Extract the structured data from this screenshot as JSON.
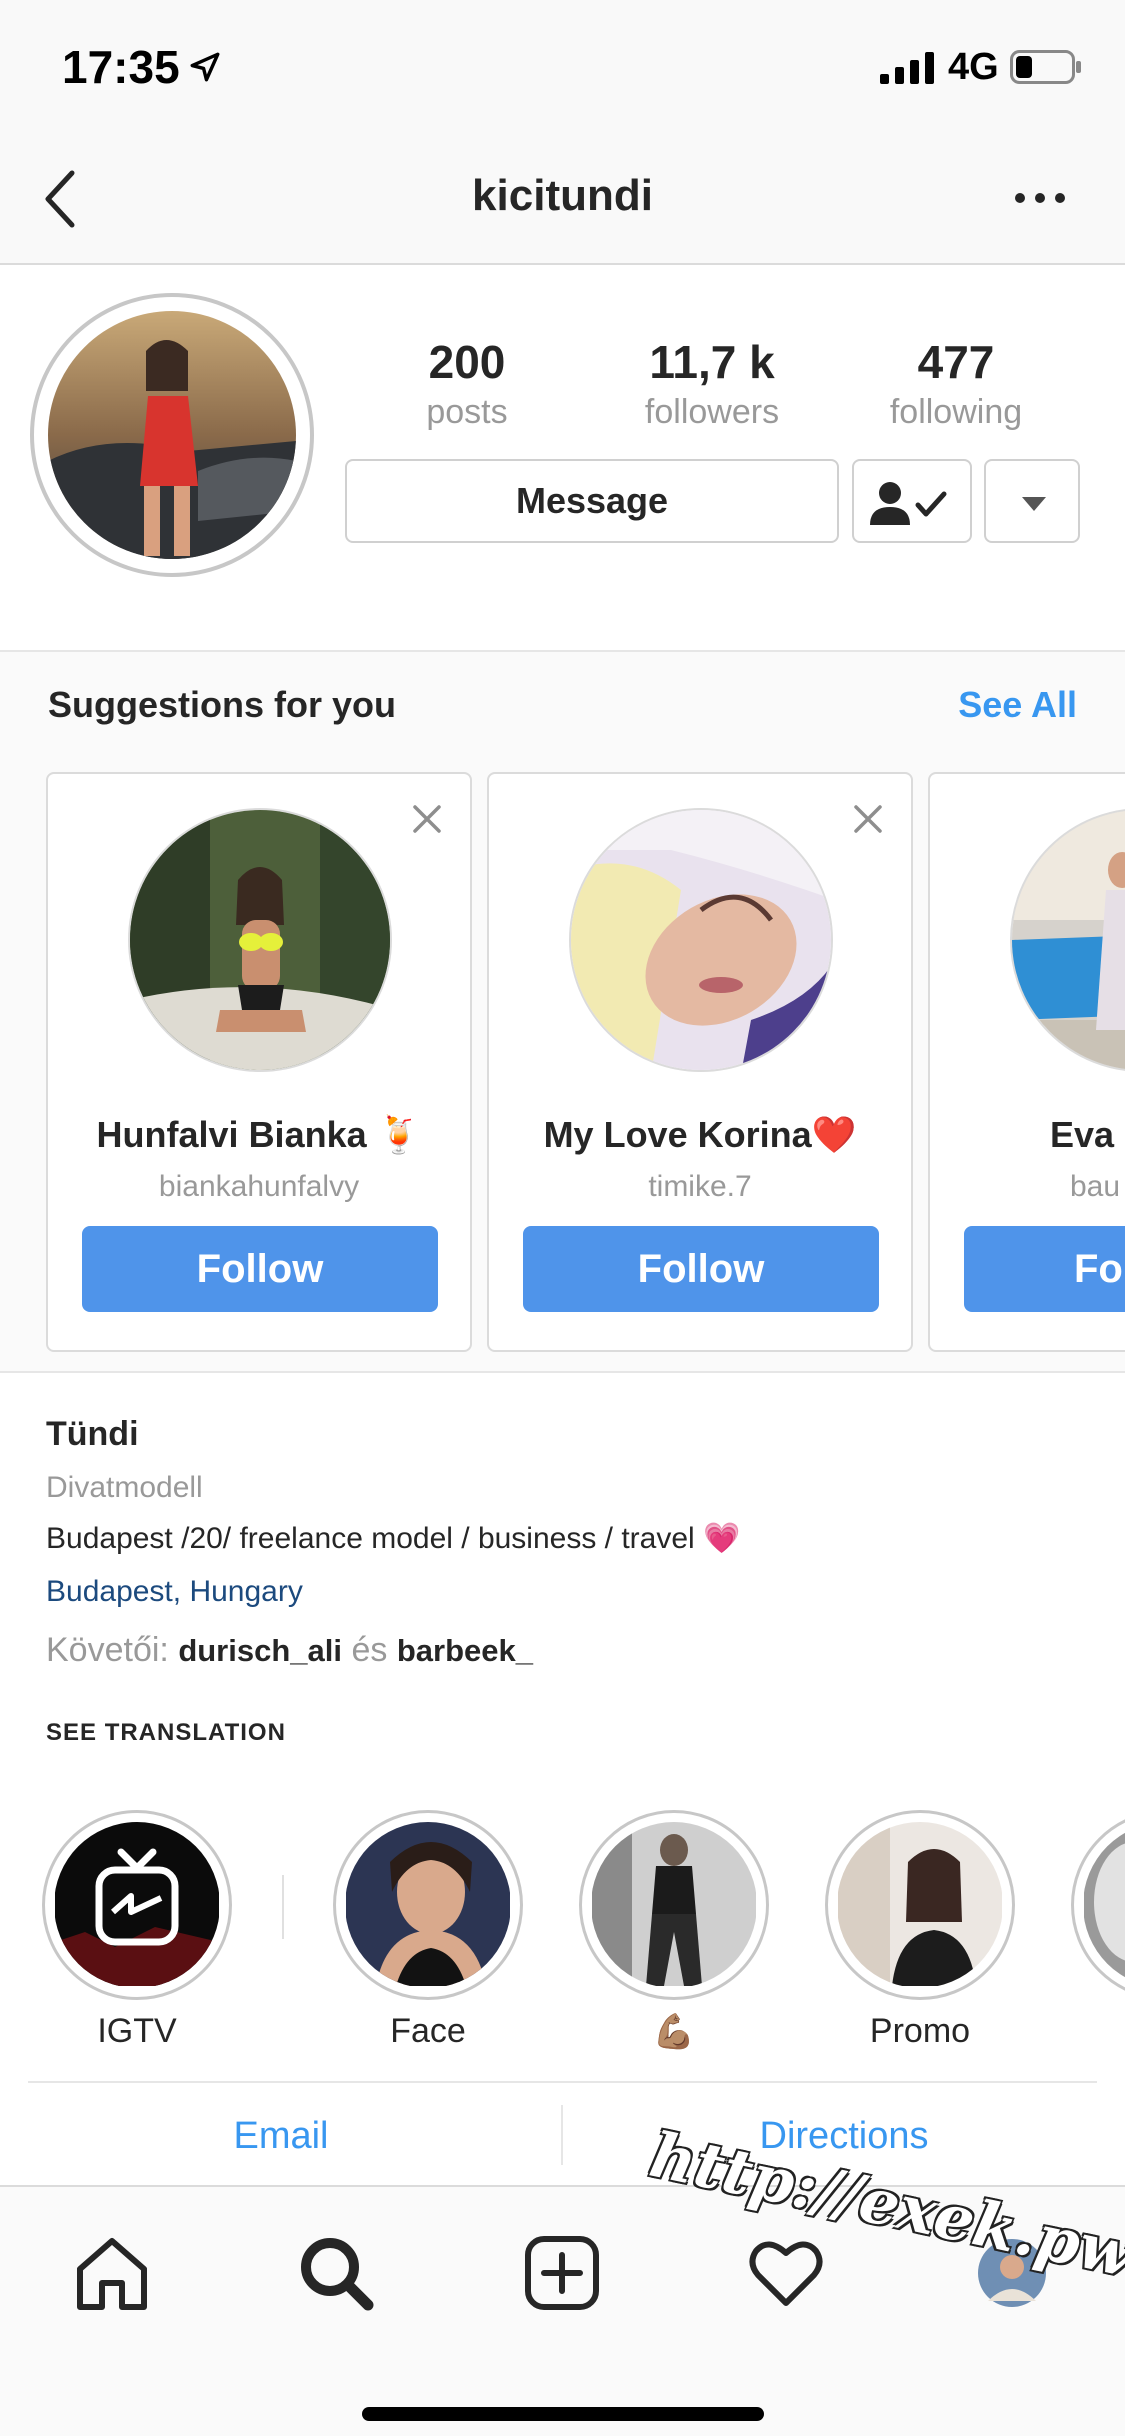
{
  "status_bar": {
    "time": "17:35",
    "network": "4G"
  },
  "nav": {
    "title": "kicitundi"
  },
  "profile": {
    "stats": [
      {
        "value": "200",
        "label": "posts"
      },
      {
        "value": "11,7 k",
        "label": "followers"
      },
      {
        "value": "477",
        "label": "following"
      }
    ],
    "message_label": "Message"
  },
  "suggestions": {
    "title": "Suggestions for you",
    "see_all": "See All",
    "cards": [
      {
        "name": "Hunfalvi Bianka 🍹",
        "username": "biankahunfalvy",
        "follow_label": "Follow"
      },
      {
        "name": "My Love Korina❤️",
        "username": "timike.7",
        "follow_label": "Follow"
      },
      {
        "name": "Eva",
        "username": "bau",
        "follow_label": "Fo"
      }
    ]
  },
  "bio": {
    "name": "Tündi",
    "category": "Divatmodell",
    "text": "Budapest /20/ freelance model / business / travel 💗",
    "location": "Budapest, Hungary",
    "followed_by_prefix": "Követői:",
    "followed_by_user1": "durisch_ali",
    "followed_by_joiner": "és",
    "followed_by_user2": "barbeek_",
    "see_translation": "SEE TRANSLATION"
  },
  "highlights": [
    {
      "label": "IGTV"
    },
    {
      "label": "Face"
    },
    {
      "label": "💪🏽"
    },
    {
      "label": "Promo"
    }
  ],
  "contact": {
    "email": "Email",
    "directions": "Directions"
  },
  "watermark": "http://exek.pw",
  "colors": {
    "accent": "#3897f0",
    "follow_button": "#4f94ea",
    "location_link": "#1c4a7e"
  }
}
